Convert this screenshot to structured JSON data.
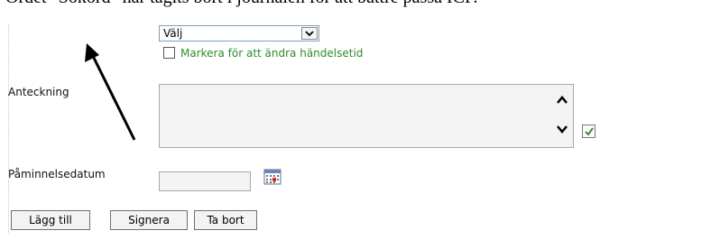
{
  "caption": "Ordet \"Sökord\" har tagits bort i journalen för att bättre passa ICF.",
  "event_select": {
    "value": "Välj"
  },
  "time_checkbox": {
    "label": "Markera för att ändra händelsetid",
    "checked": false
  },
  "note": {
    "label": "Anteckning",
    "value": ""
  },
  "reminder": {
    "label": "Påminnelsedatum",
    "value": ""
  },
  "buttons": {
    "add": "Lägg till",
    "sign": "Signera",
    "delete": "Ta bort"
  },
  "icons": {
    "select_arrow": "chevron-down-icon",
    "scroll_up": "chevron-up-icon",
    "scroll_down": "chevron-down-icon",
    "spell_check": "checkmark-icon",
    "calendar": "calendar-icon",
    "annotation_arrow": "arrow-icon"
  },
  "colors": {
    "checkbox_label": "#2e8b2e",
    "field_background": "#f3f3f3",
    "annotation_arrow": "#000000"
  }
}
